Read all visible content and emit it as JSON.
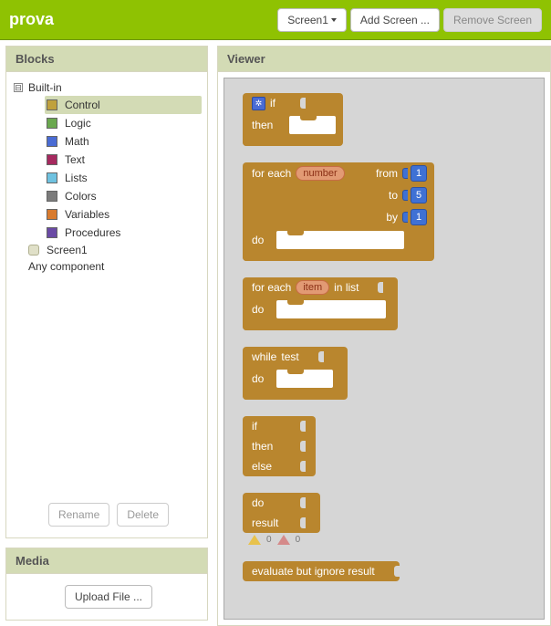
{
  "app_title": "prova",
  "toolbar": {
    "screen_select": "Screen1",
    "add_screen": "Add Screen ...",
    "remove_screen": "Remove Screen"
  },
  "panels": {
    "blocks_title": "Blocks",
    "viewer_title": "Viewer",
    "media_title": "Media",
    "upload_file": "Upload File ...",
    "rename": "Rename",
    "delete": "Delete"
  },
  "tree": {
    "built_in": "Built-in",
    "expand_symbol": "⊟",
    "categories": [
      {
        "label": "Control",
        "color": "#c0a13d",
        "selected": true
      },
      {
        "label": "Logic",
        "color": "#6aa84f"
      },
      {
        "label": "Math",
        "color": "#4a6cd4"
      },
      {
        "label": "Text",
        "color": "#a6295f"
      },
      {
        "label": "Lists",
        "color": "#6fc2e0"
      },
      {
        "label": "Colors",
        "color": "#7b7b7b"
      },
      {
        "label": "Variables",
        "color": "#d97b2e"
      },
      {
        "label": "Procedures",
        "color": "#6a4aa5"
      }
    ],
    "screen1": "Screen1",
    "any_component": "Any component"
  },
  "blocks": {
    "if": "if",
    "then": "then",
    "else": "else",
    "for_each": "for each",
    "number_param": "number",
    "item_param": "item",
    "from": "from",
    "to": "to",
    "by": "by",
    "in_list": "in list",
    "do": "do",
    "while": "while",
    "test": "test",
    "result": "result",
    "evaluate_ignore": "evaluate but ignore result",
    "vals": {
      "from": "1",
      "to": "5",
      "by": "1"
    }
  },
  "warnings": {
    "yellow": "0",
    "red": "0"
  }
}
